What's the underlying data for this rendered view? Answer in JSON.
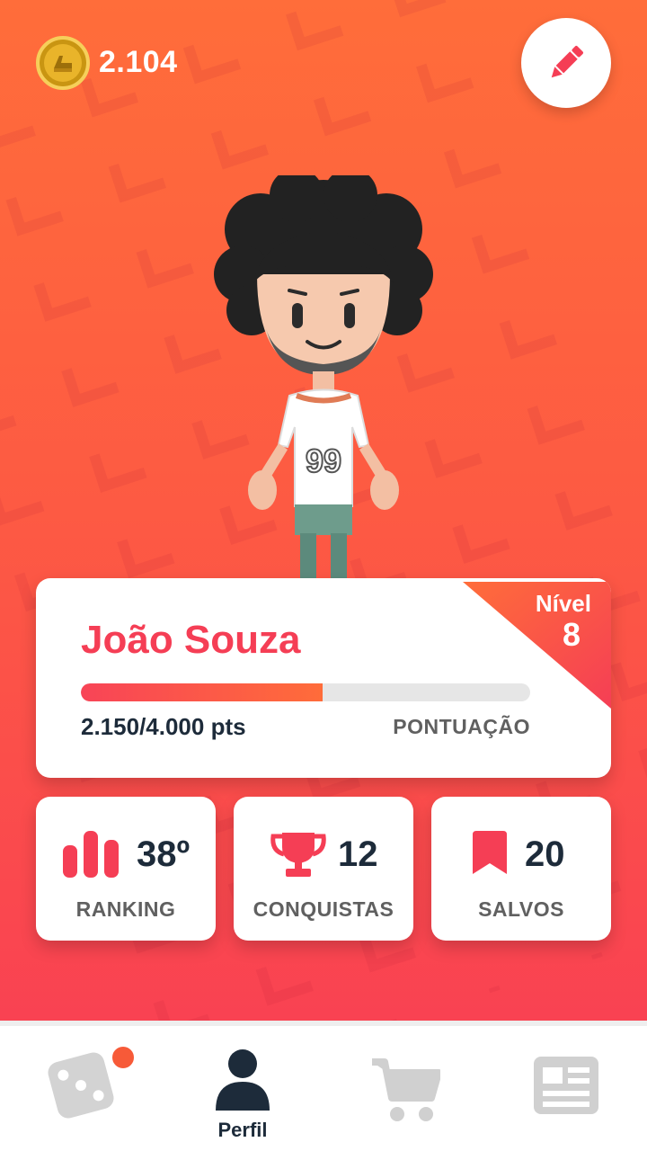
{
  "header": {
    "coins": "2.104",
    "coin_icon": "coin-icon",
    "edit_icon": "pencil-icon"
  },
  "profile": {
    "name": "João Souza",
    "points_text": "2.150/4.000 pts",
    "points_label": "PONTUAÇÃO",
    "progress": 0.5375,
    "level_label": "Nível",
    "level": "8"
  },
  "stats": [
    {
      "icon": "bar-chart-icon",
      "value": "38º",
      "label": "RANKING"
    },
    {
      "icon": "trophy-icon",
      "value": "12",
      "label": "CONQUISTAS"
    },
    {
      "icon": "bookmark-icon",
      "value": "20",
      "label": "SALVOS"
    }
  ],
  "nav": {
    "items": [
      {
        "icon": "dice-icon",
        "label": "",
        "badge": true
      },
      {
        "icon": "person-icon",
        "label": "Perfil",
        "active": true
      },
      {
        "icon": "cart-icon",
        "label": ""
      },
      {
        "icon": "news-icon",
        "label": ""
      }
    ]
  },
  "colors": {
    "accent": "#f53e55",
    "orange": "#ff6d3a",
    "dark": "#1d2b3a",
    "muted": "#606060",
    "inactive_icon": "#d0d0d0"
  }
}
